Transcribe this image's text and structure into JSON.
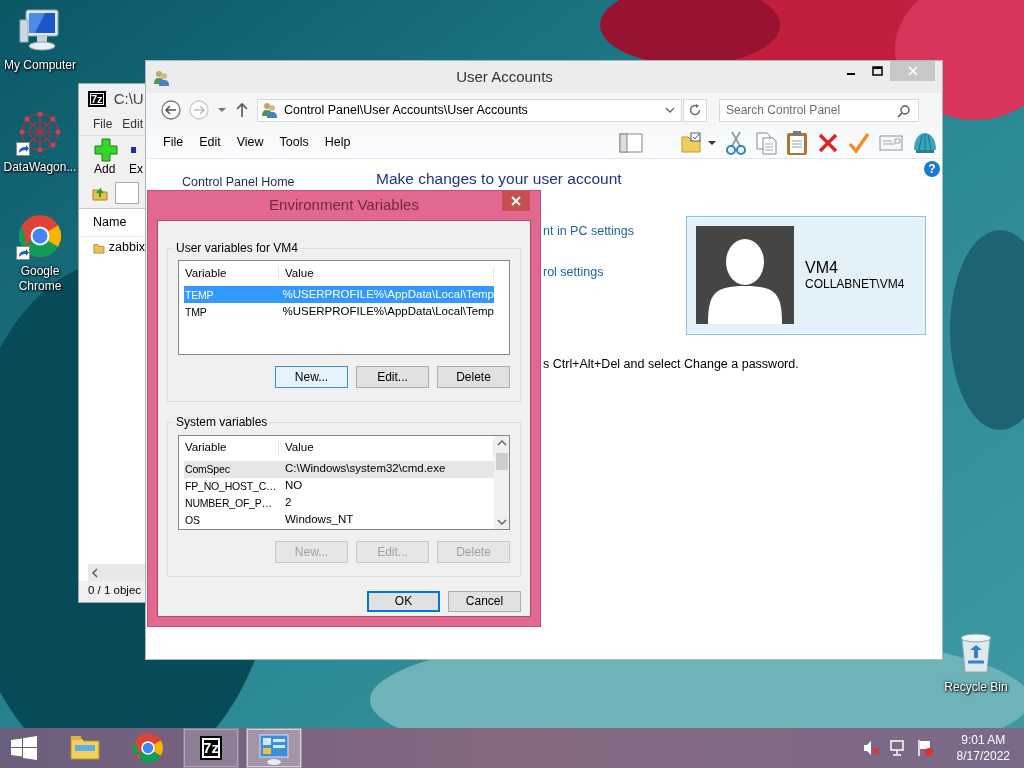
{
  "desktop_icons": [
    {
      "kind": "computer",
      "label": "My Computer",
      "shortcut": false
    },
    {
      "kind": "network",
      "label": "DataWagon...",
      "shortcut": true
    },
    {
      "kind": "chrome",
      "label": "Google Chrome",
      "shortcut": true
    },
    {
      "kind": "recycle",
      "label": "Recycle Bin",
      "shortcut": false
    }
  ],
  "archive_window": {
    "logo": "7z",
    "title": "C:\\U",
    "menu": [
      "File",
      "Edit"
    ],
    "tools": [
      {
        "kind": "add",
        "label": "Add"
      },
      {
        "kind": "extract",
        "label": "Ex"
      }
    ],
    "column": "Name",
    "files": [
      "zabbix"
    ],
    "status": "0 / 1 objec"
  },
  "user_accounts": {
    "title": "User Accounts",
    "address": "Control Panel\\User Accounts\\User Accounts",
    "search": {
      "placeholder": "Search Control Panel"
    },
    "menu": [
      "File",
      "Edit",
      "View",
      "Tools",
      "Help"
    ],
    "help": "?",
    "nav": [
      "Control Panel Home"
    ],
    "heading": "Make changes to your user account",
    "links": [
      "nt in PC settings",
      "rol settings"
    ],
    "note": "s Ctrl+Alt+Del and select Change a password.",
    "account": {
      "name": "VM4",
      "domain": "COLLABNET\\VM4"
    }
  },
  "env_dialog": {
    "title": "Environment Variables",
    "groups": [
      {
        "title": "User variables for VM4",
        "focused": true,
        "scrollbar": false,
        "columns": [
          "Variable",
          "Value"
        ],
        "rows": [
          {
            "variable": "TEMP",
            "value": "%USERPROFILE%\\AppData\\Local\\Temp",
            "selected": true
          },
          {
            "variable": "TMP",
            "value": "%USERPROFILE%\\AppData\\Local\\Temp",
            "selected": false
          }
        ],
        "buttons": [
          {
            "label": "New...",
            "disabled": false,
            "focused": true
          },
          {
            "label": "Edit...",
            "disabled": false,
            "focused": false
          },
          {
            "label": "Delete",
            "disabled": false,
            "focused": false
          }
        ]
      },
      {
        "title": "System variables",
        "focused": false,
        "scrollbar": true,
        "columns": [
          "Variable",
          "Value"
        ],
        "rows": [
          {
            "variable": "ComSpec",
            "value": "C:\\Windows\\system32\\cmd.exe",
            "selected": true
          },
          {
            "variable": "FP_NO_HOST_C…",
            "value": "NO",
            "selected": false
          },
          {
            "variable": "NUMBER_OF_P…",
            "value": "2",
            "selected": false
          },
          {
            "variable": "OS",
            "value": "Windows_NT",
            "selected": false
          }
        ],
        "buttons": [
          {
            "label": "New...",
            "disabled": true,
            "focused": false
          },
          {
            "label": "Edit...",
            "disabled": true,
            "focused": false
          },
          {
            "label": "Delete",
            "disabled": true,
            "focused": false
          }
        ]
      }
    ],
    "buttons": [
      {
        "label": "OK",
        "default": true
      },
      {
        "label": "Cancel",
        "default": false
      }
    ]
  },
  "taskbar": {
    "apps": [
      {
        "kind": "explorer",
        "open": false,
        "selected": false
      },
      {
        "kind": "chrome",
        "open": false,
        "selected": false
      },
      {
        "kind": "sevenzip",
        "label": "7z",
        "open": true,
        "selected": false
      },
      {
        "kind": "control",
        "open": true,
        "selected": true
      }
    ],
    "time": "9:01 AM",
    "date": "8/17/2022"
  }
}
